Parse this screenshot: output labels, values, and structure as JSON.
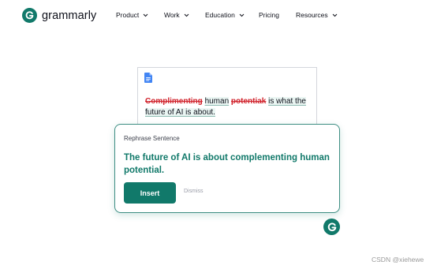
{
  "brand": {
    "name": "grammarly",
    "icon": "grammarly-g-icon",
    "accent": "#11796a"
  },
  "nav": {
    "items": [
      {
        "label": "Product",
        "has_dropdown": true
      },
      {
        "label": "Work",
        "has_dropdown": true
      },
      {
        "label": "Education",
        "has_dropdown": true
      },
      {
        "label": "Pricing",
        "has_dropdown": false
      },
      {
        "label": "Resources",
        "has_dropdown": true
      }
    ]
  },
  "document": {
    "icon": "google-docs-icon",
    "struck_1": "Complimenting",
    "kept_1": "human",
    "struck_2": "potentiak",
    "kept_2": "is what the",
    "line2": "future of AI is about."
  },
  "suggestion": {
    "title": "Rephrase Sentence",
    "text": "The future of AI is about complementing human potential.",
    "insert_label": "Insert",
    "dismiss_label": "Dismiss"
  },
  "watermark": "CSDN @xiehewe"
}
